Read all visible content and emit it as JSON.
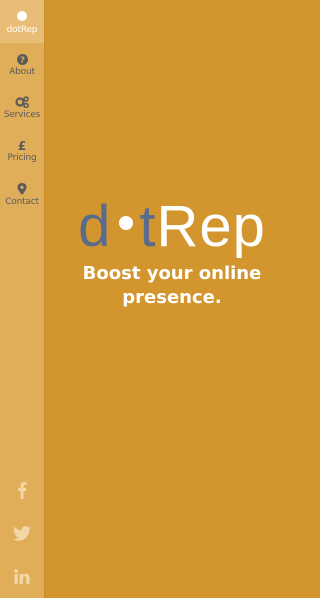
{
  "brand": {
    "sidebar_label": "dotRep",
    "logo_part1": "d",
    "logo_part2": "t",
    "logo_part3": "Rep"
  },
  "nav": {
    "items": [
      {
        "label": "About",
        "icon": "question-circle-icon"
      },
      {
        "label": "Services",
        "icon": "gears-icon"
      },
      {
        "label": "Pricing",
        "icon": "pound-icon"
      },
      {
        "label": "Contact",
        "icon": "map-marker-icon"
      }
    ]
  },
  "hero": {
    "tagline": "Boost your online presence."
  },
  "social": [
    "facebook-icon",
    "twitter-icon",
    "linkedin-icon"
  ],
  "colors": {
    "background": "#d3962f",
    "sidebar": "#e0ad59",
    "sidebar_active": "#e9bd75",
    "logo_dark": "#5a6c8c",
    "text_light": "#ffffff",
    "nav_text": "#5b5b5b"
  }
}
